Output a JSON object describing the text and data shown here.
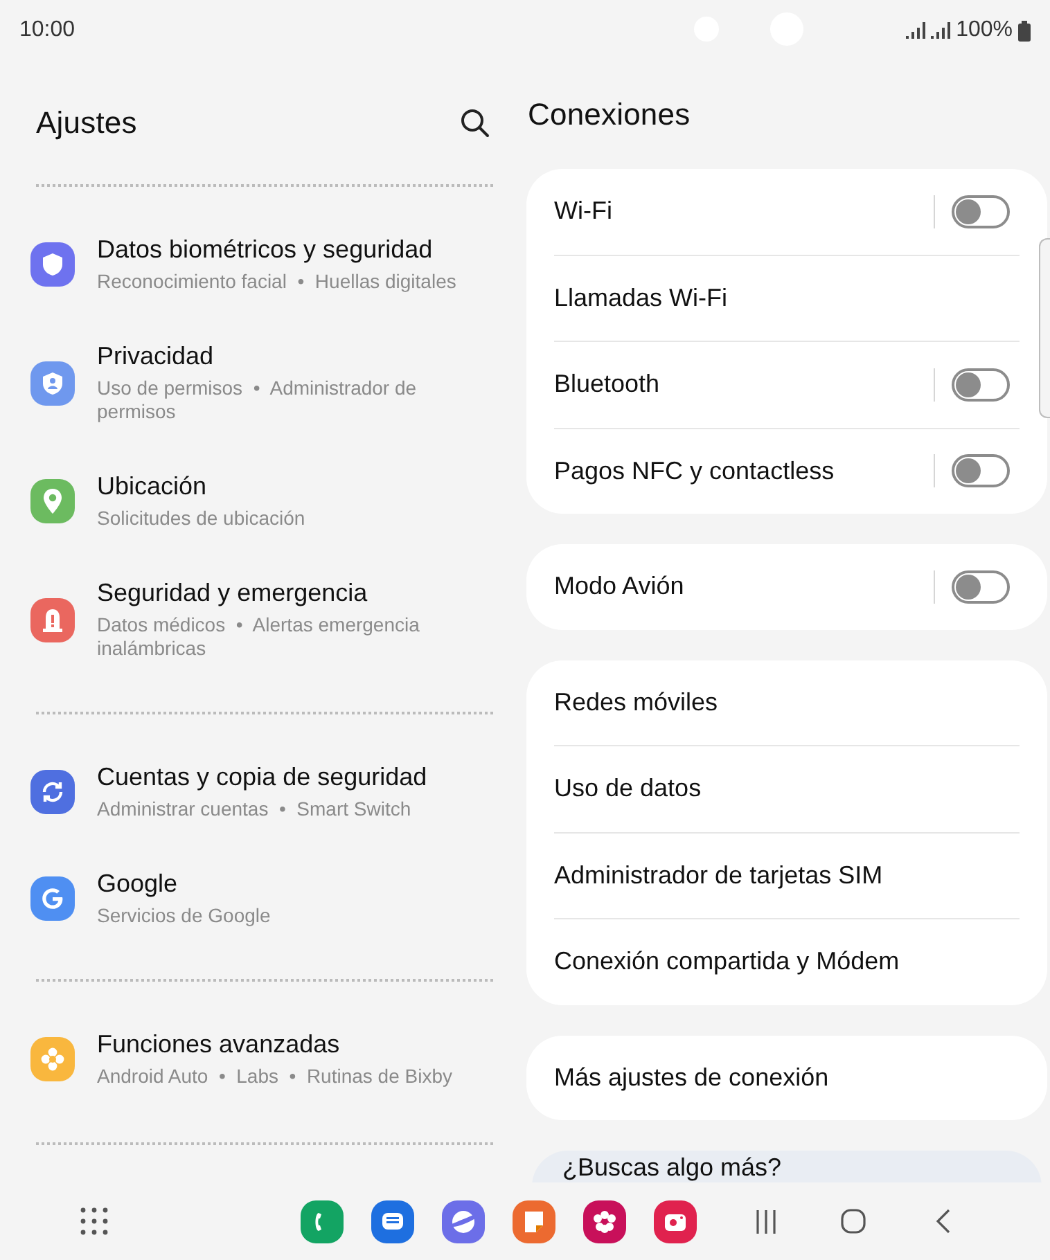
{
  "status_bar": {
    "time": "10:00",
    "battery": "100%"
  },
  "settings": {
    "title": "Ajustes",
    "groups": [
      {
        "items": [
          {
            "title": "Datos biométricos y seguridad",
            "subtitle": "Reconocimiento facial  •  Huellas digitales",
            "kind": "shield",
            "color": "#6e72ef"
          },
          {
            "title": "Privacidad",
            "subtitle": "Uso de permisos  •  Administrador de permisos",
            "kind": "privacy",
            "color": "#6f98ee"
          },
          {
            "title": "Ubicación",
            "subtitle": "Solicitudes de ubicación",
            "kind": "pin",
            "color": "#6cbb60"
          },
          {
            "title": "Seguridad y emergencia",
            "subtitle": "Datos médicos  •  Alertas emergencia inalámbricas",
            "kind": "alert",
            "color": "#ea675f"
          }
        ]
      },
      {
        "items": [
          {
            "title": "Cuentas y copia de seguridad",
            "subtitle": "Administrar cuentas  •  Smart Switch",
            "kind": "sync",
            "color": "#4f6fe0"
          },
          {
            "title": "Google",
            "subtitle": "Servicios de Google",
            "kind": "google",
            "color": "#4f8ff2"
          }
        ]
      },
      {
        "items": [
          {
            "title": "Funciones avanzadas",
            "subtitle": "Android Auto  •  Labs  •  Rutinas de Bixby",
            "kind": "gear",
            "color": "#f9b73e"
          }
        ]
      }
    ]
  },
  "connections": {
    "title": "Conexiones",
    "cards": [
      {
        "rows": [
          {
            "label": "Wi-Fi",
            "kind": "toggle",
            "on": false
          },
          {
            "label": "Llamadas Wi-Fi",
            "kind": "link"
          },
          {
            "label": "Bluetooth",
            "kind": "toggle",
            "on": false
          },
          {
            "label": "Pagos NFC y contactless",
            "kind": "toggle",
            "on": false
          }
        ]
      },
      {
        "rows": [
          {
            "label": "Modo Avión",
            "kind": "toggle",
            "on": false
          }
        ]
      },
      {
        "rows": [
          {
            "label": "Redes móviles",
            "kind": "link"
          },
          {
            "label": "Uso de datos",
            "kind": "link"
          },
          {
            "label": "Administrador de tarjetas SIM",
            "kind": "link"
          },
          {
            "label": "Conexión compartida y Módem",
            "kind": "link"
          }
        ]
      },
      {
        "rows": [
          {
            "label": "Más ajustes de conexión",
            "kind": "link"
          }
        ]
      }
    ],
    "more": "¿Buscas algo más?"
  }
}
